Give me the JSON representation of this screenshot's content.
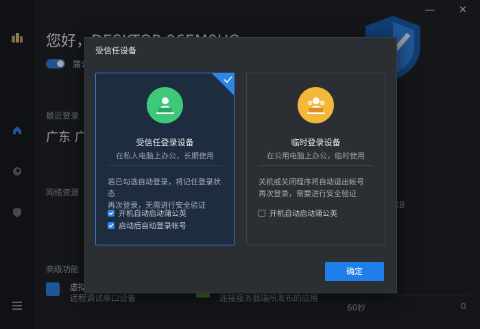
{
  "window": {
    "greeting": "您好，DESKTOP-06EM0HQ",
    "toggle_label": "蒲公",
    "last_login_label": "最近登录（",
    "last_login_location": "广东 广",
    "network_label": "网络资源",
    "speed_fragment": "KB",
    "advanced_label": "高级功能",
    "feature1_title": "虚拟",
    "feature1_desc": "远程调试串口设备",
    "feature2_desc": "连接服务器端所发布的应用",
    "timer_label": "60秒",
    "timer_value": "0",
    "close_glyph": "✕",
    "minimize_glyph": "—"
  },
  "dialog": {
    "title": "受信任设备",
    "confirm_label": "确定",
    "cards": [
      {
        "title": "受信任登录设备",
        "subtitle": "在私人电脑上办公，长期使用",
        "desc_line1": "若已勾选自动登录，将记住登录状态",
        "desc_line2": "再次登录，无需进行安全验证",
        "options": [
          {
            "label": "开机自动启动蒲公英",
            "checked": true
          },
          {
            "label": "启动后自动登录帐号",
            "checked": true
          }
        ],
        "selected": true
      },
      {
        "title": "临时登录设备",
        "subtitle": "在公用电脑上办公，临时使用",
        "desc_line1": "关机或关闭程序将自动退出帐号",
        "desc_line2": "再次登录，需要进行安全验证",
        "options": [
          {
            "label": "开机自动启动蒲公英",
            "checked": false
          }
        ],
        "selected": false
      }
    ]
  },
  "colors": {
    "accent": "#1f7ee8",
    "trusted_icon": "#3ec97a",
    "temp_icon": "#f3b73a"
  },
  "icons": [
    "app-logo-icon",
    "home-icon",
    "globe-icon",
    "shield-nav-icon",
    "menu-icon",
    "check-icon",
    "shield-icon"
  ]
}
